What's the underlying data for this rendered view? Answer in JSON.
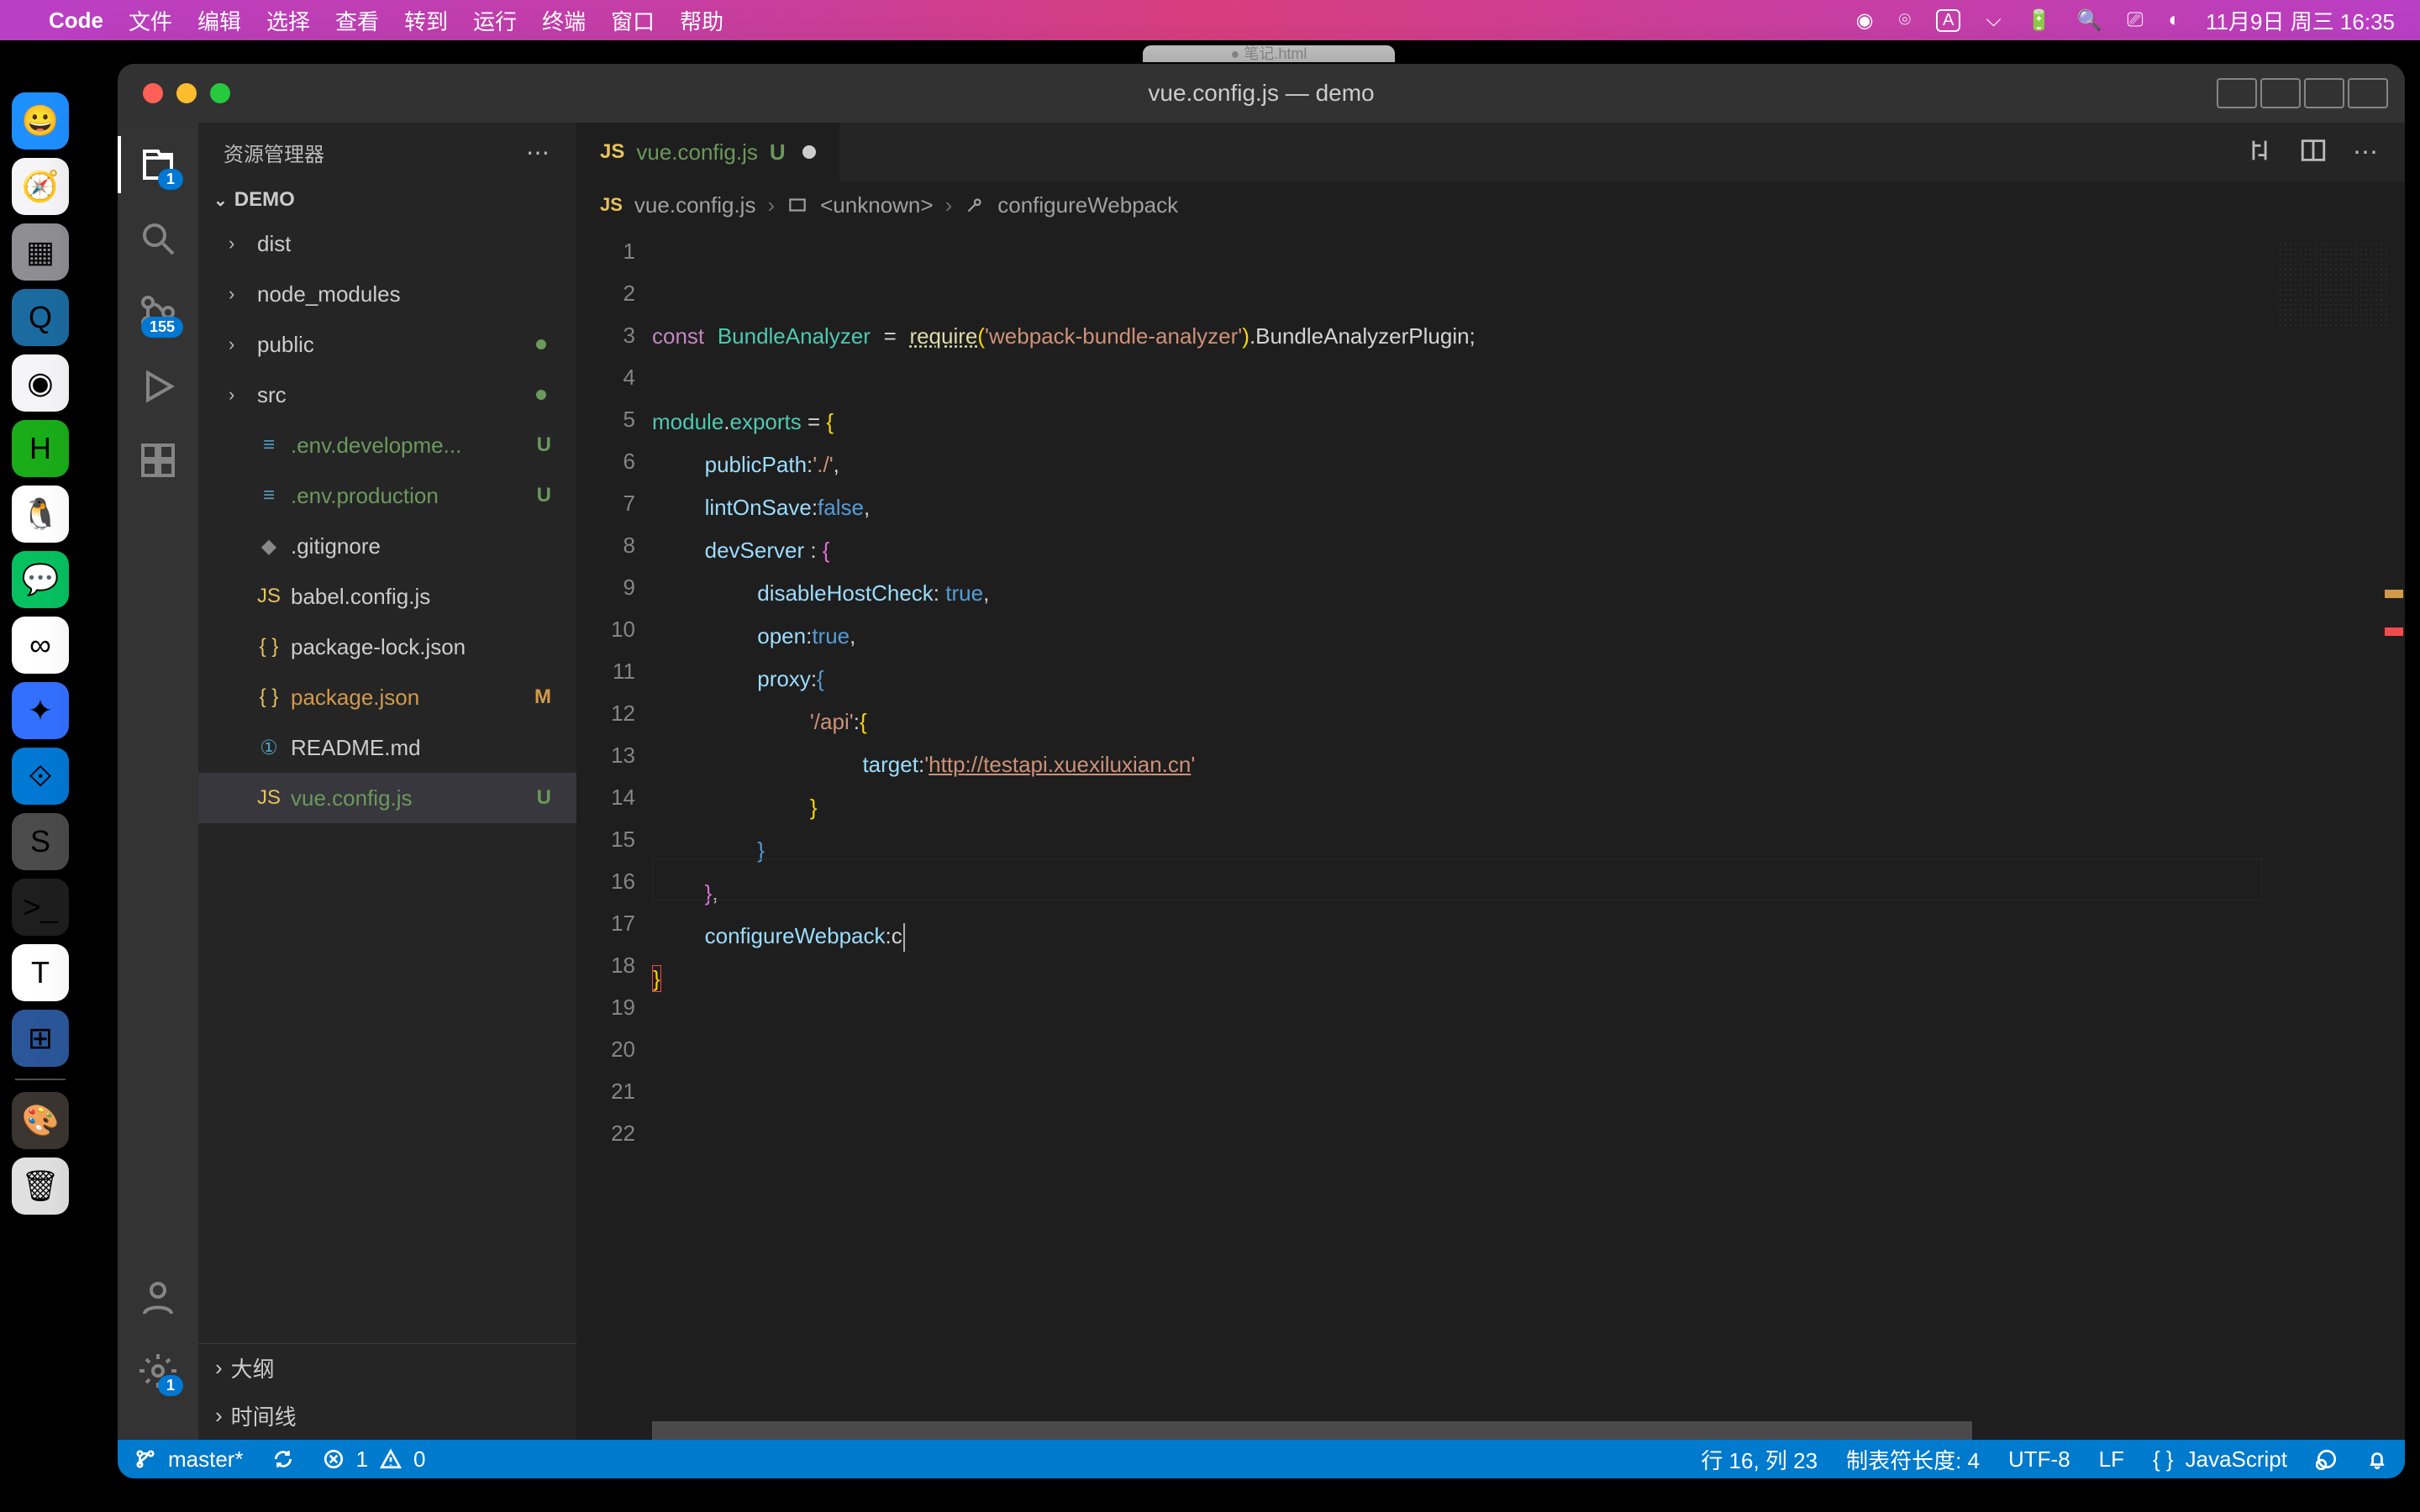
{
  "menubar": {
    "app": "Code",
    "items": [
      "文件",
      "编辑",
      "选择",
      "查看",
      "转到",
      "运行",
      "终端",
      "窗口",
      "帮助"
    ],
    "right": {
      "date": "11月9日 周三 16:35"
    }
  },
  "bg_tab": "● 笔记.html",
  "dock": {
    "items": [
      {
        "name": "finder",
        "emoji": "😀",
        "bg": "#1e8fff"
      },
      {
        "name": "safari",
        "emoji": "🧭",
        "bg": "#f5f5f7"
      },
      {
        "name": "launchpad",
        "emoji": "▦",
        "bg": "#8e8e93"
      },
      {
        "name": "quicktime",
        "emoji": "Q",
        "bg": "#1b6ba0"
      },
      {
        "name": "chrome",
        "emoji": "◉",
        "bg": "#f5f5f7"
      },
      {
        "name": "hbuilder",
        "emoji": "H",
        "bg": "#1aad19"
      },
      {
        "name": "qq",
        "emoji": "🐧",
        "bg": "#ffffff"
      },
      {
        "name": "wechat",
        "emoji": "💬",
        "bg": "#07c160"
      },
      {
        "name": "baidu",
        "emoji": "∞",
        "bg": "#ffffff"
      },
      {
        "name": "feishu",
        "emoji": "✦",
        "bg": "#3370ff"
      },
      {
        "name": "vscode",
        "emoji": "⟐",
        "bg": "#0078d4"
      },
      {
        "name": "sublime",
        "emoji": "S",
        "bg": "#4b4b4b"
      },
      {
        "name": "terminal",
        "emoji": ">_",
        "bg": "#1e1e1e"
      },
      {
        "name": "text",
        "emoji": "T",
        "bg": "#ffffff"
      },
      {
        "name": "office",
        "emoji": "⊞",
        "bg": "#2b579a"
      },
      {
        "name": "paint",
        "emoji": "🎨",
        "bg": "#3a3530"
      },
      {
        "name": "trash",
        "emoji": "🗑",
        "bg": "#e0e0e0"
      }
    ]
  },
  "win_title": "vue.config.js — demo",
  "sidebar": {
    "title": "资源管理器",
    "project": "DEMO",
    "tree": [
      {
        "kind": "folder",
        "label": "dist"
      },
      {
        "kind": "folder",
        "label": "node_modules"
      },
      {
        "kind": "folder",
        "label": "public",
        "state": "dot"
      },
      {
        "kind": "folder",
        "label": "src",
        "state": "dot"
      },
      {
        "kind": "file",
        "icon": "env",
        "label": ".env.developme...",
        "git": "U",
        "cls": "green"
      },
      {
        "kind": "file",
        "icon": "env",
        "label": ".env.production",
        "git": "U",
        "cls": "green"
      },
      {
        "kind": "file",
        "icon": "git",
        "label": ".gitignore"
      },
      {
        "kind": "file",
        "icon": "js",
        "label": "babel.config.js"
      },
      {
        "kind": "file",
        "icon": "json",
        "label": "package-lock.json"
      },
      {
        "kind": "file",
        "icon": "json",
        "label": "package.json",
        "git": "M",
        "cls": "yellow"
      },
      {
        "kind": "file",
        "icon": "md",
        "label": "README.md"
      },
      {
        "kind": "file",
        "icon": "js",
        "label": "vue.config.js",
        "git": "U",
        "cls": "green",
        "selected": true
      }
    ],
    "foot": [
      "大纲",
      "时间线"
    ]
  },
  "activity": {
    "scm_badge": "155",
    "explorer_badge": "1",
    "settings_badge": "1"
  },
  "tab": {
    "icon": "JS",
    "label": "vue.config.js",
    "marker": "U"
  },
  "breadcrumb": {
    "file": "vue.config.js",
    "mid": "<unknown>",
    "leaf": "configureWebpack"
  },
  "gutter_lines": [
    "1",
    "2",
    "3",
    "4",
    "5",
    "6",
    "7",
    "8",
    "9",
    "10",
    "11",
    "12",
    "13",
    "14",
    "15",
    "16",
    "17",
    "18",
    "19",
    "20",
    "21",
    "22"
  ],
  "code": {
    "l2a": "const",
    "l2b": "BundleAnalyzer",
    "l2c": "=",
    "l2d": "require",
    "l2e": "(",
    "l2f": "'webpack-bundle-analyzer'",
    "l2g": ")",
    "l2h": ".BundleAnalyzerPlugin;",
    "l4a": "module",
    "l4b": ".",
    "l4c": "exports",
    "l4d": " = ",
    "l4e": "{",
    "l5a": "publicPath",
    "l5b": ":",
    "l5c": "'./'",
    "l6a": "lintOnSave",
    "l6b": ":",
    "l6c": "false",
    "l7a": "devServer",
    "l7b": " : ",
    "l7c": "{",
    "l8a": "disableHostCheck",
    "l8b": ": ",
    "l8c": "true",
    "l9a": "open",
    "l9b": ":",
    "l9c": "true",
    "l10a": "proxy",
    "l10b": ":",
    "l10c": "{",
    "l11a": "'/api'",
    "l11b": ":",
    "l11c": "{",
    "l12a": "target",
    "l12b": ":",
    "l12c": "'",
    "l12d": "http://testapi.xuexiluxian.cn",
    "l12e": "'",
    "l16a": "configureWebpack",
    "l16b": ":",
    "l16c": "c",
    "brace_close": "}",
    "comma": ","
  },
  "status": {
    "branch": "master*",
    "errors": "1",
    "warnings": "0",
    "pos": "行 16, 列 23",
    "tab": "制表符长度: 4",
    "enc": "UTF-8",
    "eol": "LF",
    "lang": "JavaScript"
  }
}
